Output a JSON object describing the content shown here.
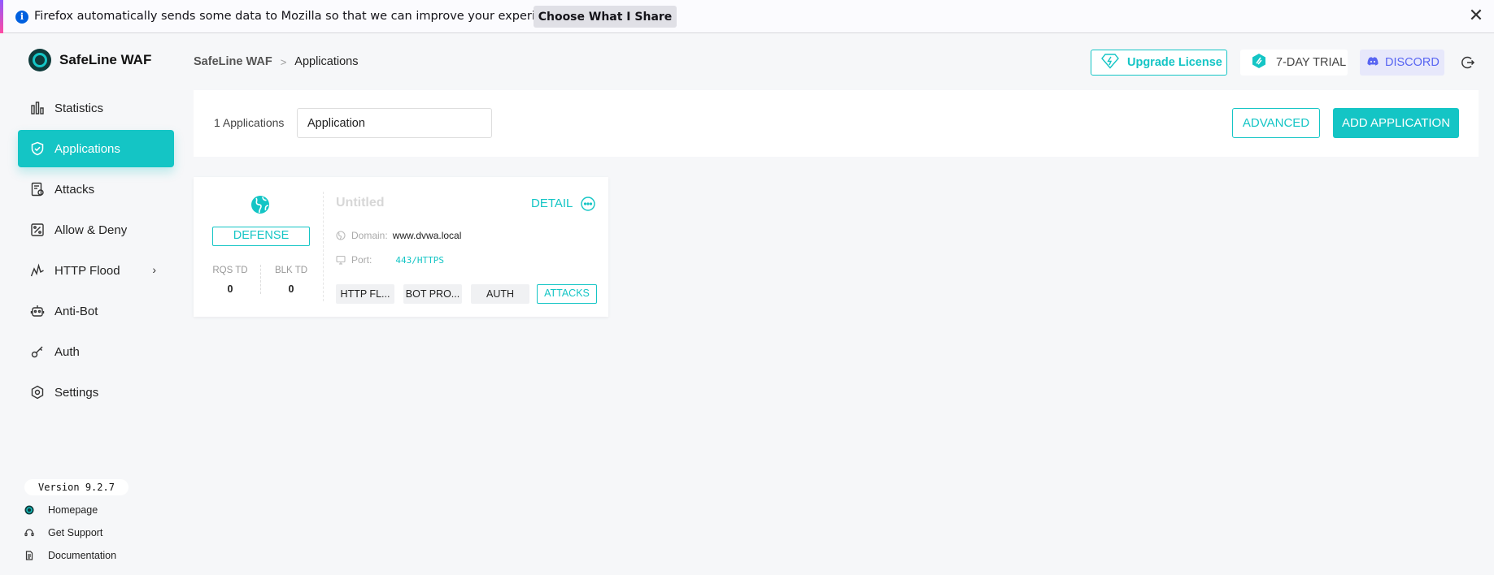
{
  "notification": {
    "message": "Firefox automatically sends some data to Mozilla so that we can improve your experience.",
    "button_label": "Choose What I Share",
    "close_symbol": "✕"
  },
  "brand": {
    "name": "SafeLine WAF"
  },
  "nav": {
    "items": [
      {
        "label": "Statistics",
        "icon": "bar-chart-icon"
      },
      {
        "label": "Applications",
        "icon": "shield-icon",
        "active": true
      },
      {
        "label": "Attacks",
        "icon": "attack-log-icon"
      },
      {
        "label": "Allow & Deny",
        "icon": "percent-icon"
      },
      {
        "label": "HTTP Flood",
        "icon": "pulse-icon",
        "expandable": true
      },
      {
        "label": "Anti-Bot",
        "icon": "robot-icon"
      },
      {
        "label": "Auth",
        "icon": "key-icon"
      },
      {
        "label": "Settings",
        "icon": "gear-icon"
      }
    ]
  },
  "footer": {
    "version": "Version 9.2.7",
    "links": [
      "Homepage",
      "Get Support",
      "Documentation"
    ]
  },
  "breadcrumb": {
    "root": "SafeLine WAF",
    "current": "Applications"
  },
  "header": {
    "upgrade_label": "Upgrade License",
    "trial_label": "7-DAY TRIAL",
    "discord_label": "DISCORD"
  },
  "toolbar": {
    "count_text": "1 Applications",
    "search_value": "Application",
    "advanced_label": "ADVANCED",
    "add_label": "ADD APPLICATION"
  },
  "app_card": {
    "mode": "DEFENSE",
    "stats": [
      {
        "label": "RQS TD",
        "value": "0"
      },
      {
        "label": "BLK TD",
        "value": "0"
      }
    ],
    "title": "Untitled",
    "detail_label": "DETAIL",
    "domain_label": "Domain:",
    "domain_value": "www.dvwa.local",
    "port_label": "Port:",
    "port_value": "443/HTTPS",
    "tags": [
      "HTTP FL...",
      "BOT PRO...",
      "AUTH",
      "ATTACKS"
    ]
  },
  "colors": {
    "accent": "#14c5c5",
    "discord": "#5865f2"
  }
}
